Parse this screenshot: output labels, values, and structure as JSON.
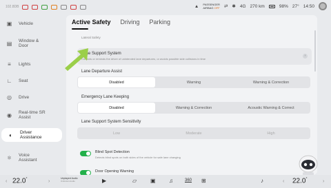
{
  "status": {
    "left_text": "102.8DB",
    "airbag_line1": "PASSENGER",
    "airbag_line2": "AIRBAG",
    "airbag_state": "OFF",
    "range": "270 km",
    "battery": "98%",
    "temperature": "27°",
    "time": "14:50",
    "signal": "4G"
  },
  "sidebar": {
    "items": [
      {
        "label": "Vehicle",
        "icon": "car-icon"
      },
      {
        "label": "Window & Door",
        "icon": "window-icon"
      },
      {
        "label": "Lights",
        "icon": "light-icon"
      },
      {
        "label": "Seat",
        "icon": "seat-icon"
      },
      {
        "label": "Drive",
        "icon": "steering-icon"
      },
      {
        "label": "Real-time SR Assist",
        "icon": "radar-icon"
      },
      {
        "label": "Driver Assistance",
        "icon": "driver-assist-icon"
      },
      {
        "label": "Voice Assistant",
        "icon": "voice-icon"
      }
    ]
  },
  "tabs": [
    "Active Safety",
    "Driving",
    "Parking"
  ],
  "section_label": "Lateral Safety",
  "lss": {
    "title": "Lane Support System",
    "subtitle": "Corrects or reminds the driver of unintended lane departures, or avoids possible side collisions in time"
  },
  "lda": {
    "title": "Lane Departure Assist",
    "options": [
      "Disabled",
      "Warning",
      "Warning & Correction"
    ],
    "selected": "Disabled"
  },
  "elk": {
    "title": "Emergency Lane Keeping",
    "options": [
      "Disabled",
      "Warning & Correction",
      "Acoustic Warning & Correct"
    ],
    "selected": "Disabled"
  },
  "sensitivity": {
    "title": "Lane Support System Sensitivity",
    "options": [
      "Low",
      "Moderate",
      "High"
    ]
  },
  "bsd": {
    "title": "Blind Spot Detection",
    "subtitle": "Detects blind spots on both sides of the vehicle for safe lane changing"
  },
  "dow": {
    "title": "Door Opening Warning"
  },
  "dock": {
    "left_temp": "22.0",
    "right_temp": "22.0",
    "media_line1": "Unplayed Audio",
    "media_line2": "Unknown Audio",
    "seat_speed": "360"
  },
  "colors": {
    "accent_green": "#22b04a",
    "arrow_green": "#9bcf4a"
  }
}
